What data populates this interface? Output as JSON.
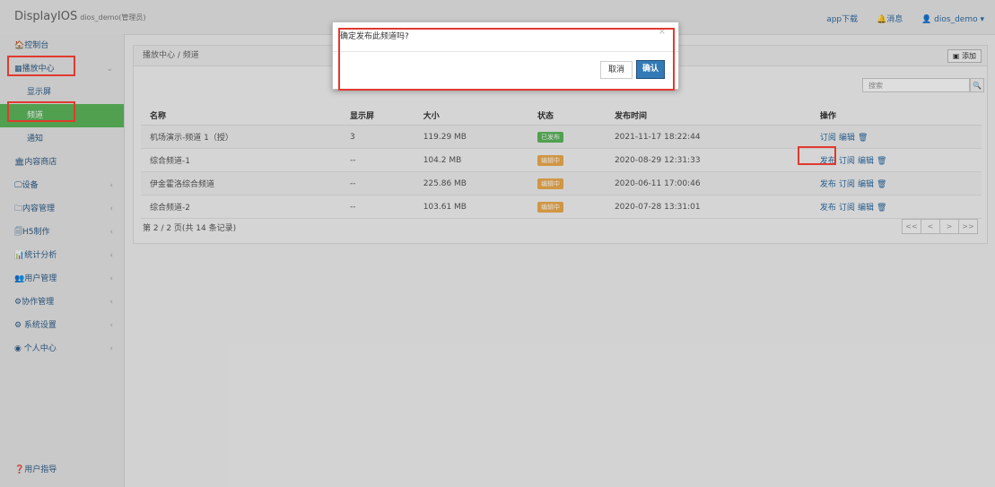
{
  "header": {
    "brand": "DisplayIOS",
    "brand_sub": "dios_demo(管理员)",
    "app_download": "app下载",
    "messages": "🔔消息",
    "user": "👤 dios_demo ▾"
  },
  "sidebar": {
    "items": [
      {
        "label": "🏠控制台",
        "arrow": ""
      },
      {
        "label": "▦播放中心",
        "arrow": "⌄"
      },
      {
        "label": "显示屏",
        "arrow": ""
      },
      {
        "label": "频道",
        "arrow": ""
      },
      {
        "label": "通知",
        "arrow": ""
      },
      {
        "label": "🏛内容商店",
        "arrow": ""
      },
      {
        "label": "🖵设备",
        "arrow": "‹"
      },
      {
        "label": "🗀内容管理",
        "arrow": "‹"
      },
      {
        "label": "🗐H5制作",
        "arrow": "‹"
      },
      {
        "label": "📊统计分析",
        "arrow": "‹"
      },
      {
        "label": "👥用户管理",
        "arrow": "‹"
      },
      {
        "label": "⚙协作管理",
        "arrow": "‹"
      },
      {
        "label": "⚙ 系统设置",
        "arrow": "‹"
      },
      {
        "label": "◉ 个人中心",
        "arrow": "‹"
      }
    ],
    "footer": "❓用户指导"
  },
  "panel": {
    "breadcrumb": "播放中心  /  频道",
    "add_label": "▣ 添加",
    "search_placeholder": "搜索",
    "search_icon": "🔍"
  },
  "table": {
    "headers": [
      "名称",
      "显示屏",
      "大小",
      "状态",
      "发布时间",
      "操作"
    ],
    "rows": [
      {
        "name": "机场演示-频道 1（授）",
        "screens": "3",
        "size": "119.29 MB",
        "status": "已发布",
        "status_color": "#5cb85c",
        "time": "2021-11-17 18:22:44",
        "ops": [
          "订阅",
          "编辑",
          "🗑"
        ]
      },
      {
        "name": "综合频道-1",
        "screens": "--",
        "size": "104.2 MB",
        "status": "编辑中",
        "status_color": "#f0ad4e",
        "time": "2020-08-29 12:31:33",
        "ops": [
          "发布",
          "订阅",
          "编辑",
          "🗑"
        ]
      },
      {
        "name": "伊金霍洛综合频道",
        "screens": "--",
        "size": "225.86 MB",
        "status": "编辑中",
        "status_color": "#f0ad4e",
        "time": "2020-06-11 17:00:46",
        "ops": [
          "发布",
          "订阅",
          "编辑",
          "🗑"
        ]
      },
      {
        "name": "综合频道-2",
        "screens": "--",
        "size": "103.61 MB",
        "status": "编辑中",
        "status_color": "#f0ad4e",
        "time": "2020-07-28 13:31:01",
        "ops": [
          "发布",
          "订阅",
          "编辑",
          "🗑"
        ]
      }
    ]
  },
  "pager": {
    "info": "第 2 / 2 页(共 14 条记录)",
    "buttons": [
      "<<",
      "<",
      ">",
      ">>"
    ]
  },
  "modal": {
    "message": "确定发布此频道吗?",
    "close": "×",
    "cancel": "取消",
    "confirm": "确认"
  }
}
